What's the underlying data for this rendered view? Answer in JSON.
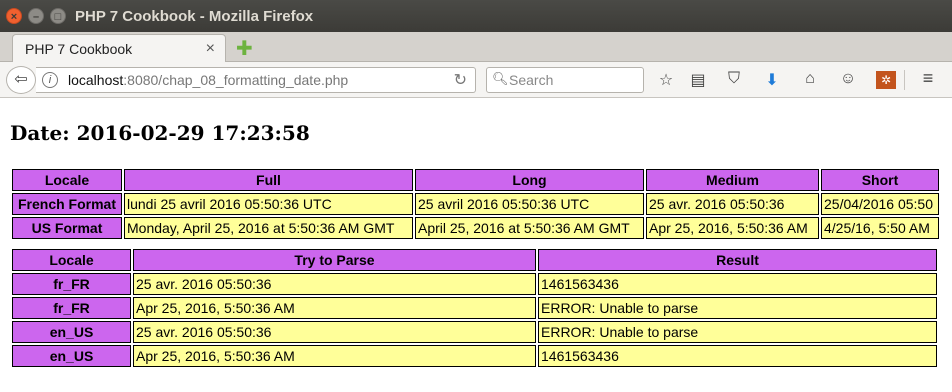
{
  "window": {
    "title": "PHP 7 Cookbook - Mozilla Firefox"
  },
  "tab": {
    "label": "PHP 7 Cookbook",
    "close_glyph": "×",
    "new_tab_glyph": "✚"
  },
  "nav": {
    "url_host": "localhost",
    "url_rest": ":8080/chap_08_formatting_date.php",
    "search_placeholder": "Search",
    "icons": [
      "back-icon",
      "info-icon",
      "reload-icon",
      "search-icon",
      "bookmark-star-icon",
      "reading-list-icon",
      "pocket-icon",
      "download-icon",
      "home-icon",
      "emoji-icon",
      "addon-icon",
      "menu-icon"
    ]
  },
  "page": {
    "heading": "Date: 2016-02-29 17:23:58"
  },
  "format_table": {
    "headers": [
      "Locale",
      "Full",
      "Long",
      "Medium",
      "Short"
    ],
    "rows": [
      [
        "French Format",
        "lundi 25 avril 2016 05:50:36 UTC",
        "25 avril 2016 05:50:36 UTC",
        "25 avr. 2016 05:50:36",
        "25/04/2016 05:50"
      ],
      [
        "US Format",
        "Monday, April 25, 2016 at 5:50:36 AM GMT",
        "April 25, 2016 at 5:50:36 AM GMT",
        "Apr 25, 2016, 5:50:36 AM",
        "4/25/16, 5:50 AM"
      ]
    ]
  },
  "parse_table": {
    "headers": [
      "Locale",
      "Try to Parse",
      "Result"
    ],
    "rows": [
      [
        "fr_FR",
        "25 avr. 2016 05:50:36",
        "1461563436"
      ],
      [
        "fr_FR",
        "Apr 25, 2016, 5:50:36 AM",
        "ERROR: Unable to parse"
      ],
      [
        "en_US",
        "25 avr. 2016 05:50:36",
        "ERROR: Unable to parse"
      ],
      [
        "en_US",
        "Apr 25, 2016, 5:50:36 AM",
        "1461563436"
      ]
    ]
  },
  "colors": {
    "header_bg": "#cc66ee",
    "cell_bg": "#ffff99"
  }
}
